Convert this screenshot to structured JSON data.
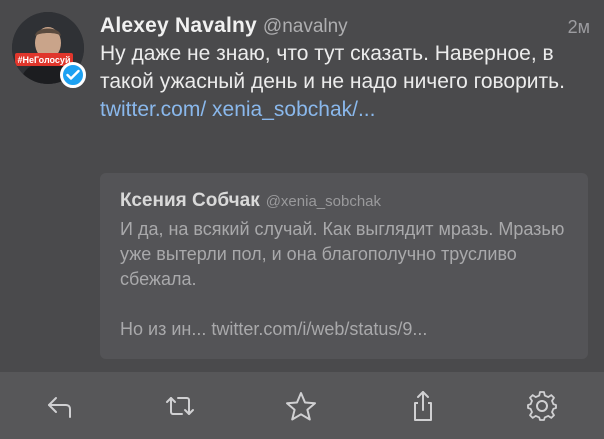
{
  "tweet": {
    "author_name": "Alexey Navalny",
    "author_handle": "@navalny",
    "time": "2м",
    "text": "Ну даже не знаю, что тут сказать. Наверное, в такой ужасный день и не надо ничего говорить.",
    "link_text": "twitter.com/ xenia_sobchak/...",
    "avatar_badge_text": "#НеГолосуй"
  },
  "quoted_tweet": {
    "author_name": "Ксения Собчак",
    "author_handle": "@xenia_sobchak",
    "text": "И да, на всякий случай. Как выглядит мразь. Мразью уже вытерли пол, и она благополучно трусливо сбежала.",
    "more_text": "Но из ин... twitter.com/i/web/status/9..."
  },
  "toolbar": {
    "buttons": [
      {
        "icon": "reply-icon"
      },
      {
        "icon": "retweet-icon"
      },
      {
        "icon": "like-star-icon"
      },
      {
        "icon": "share-icon"
      },
      {
        "icon": "settings-gear-icon"
      }
    ]
  },
  "colors": {
    "background": "#4a4a4c",
    "toolbar": "#575759",
    "link": "#8ab8ec",
    "verified": "#1da1f2",
    "badge": "#e0362c"
  }
}
